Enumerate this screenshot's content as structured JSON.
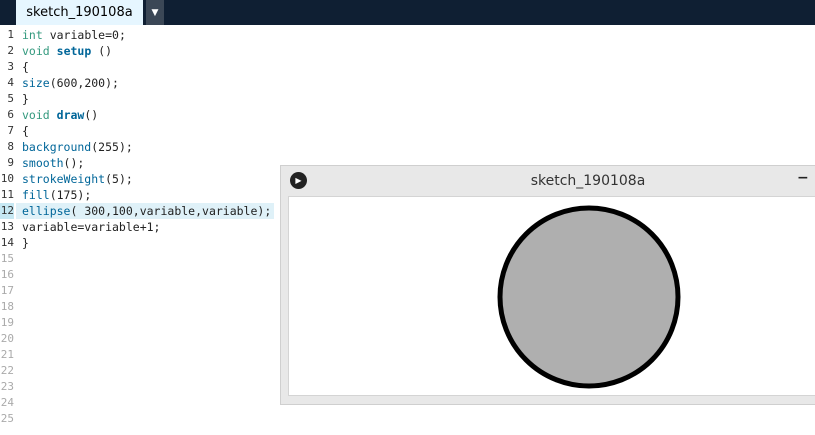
{
  "tab": {
    "label": "sketch_190108a",
    "menu_icon": "dropdown-triangle-icon"
  },
  "editor": {
    "current_line": 12,
    "line_numbers": [
      "1",
      "2",
      "3",
      "4",
      "5",
      "6",
      "7",
      "8",
      "9",
      "10",
      "11",
      "12",
      "13",
      "14",
      "15",
      "16",
      "17",
      "18",
      "19",
      "20",
      "21",
      "22",
      "23",
      "24",
      "25"
    ],
    "lines": [
      [
        {
          "t": "int",
          "c": "type"
        },
        {
          "t": " variable=0;",
          "c": ""
        }
      ],
      [
        {
          "t": "void",
          "c": "type"
        },
        {
          "t": " ",
          "c": ""
        },
        {
          "t": "setup",
          "c": "kw-bold"
        },
        {
          "t": " ()",
          "c": ""
        }
      ],
      [
        {
          "t": "{",
          "c": ""
        }
      ],
      [
        {
          "t": "size",
          "c": "fn"
        },
        {
          "t": "(600,200);",
          "c": ""
        }
      ],
      [
        {
          "t": "}",
          "c": ""
        }
      ],
      [
        {
          "t": "void",
          "c": "type"
        },
        {
          "t": " ",
          "c": ""
        },
        {
          "t": "draw",
          "c": "kw-bold"
        },
        {
          "t": "()",
          "c": ""
        }
      ],
      [
        {
          "t": "{",
          "c": ""
        }
      ],
      [
        {
          "t": "background",
          "c": "fn"
        },
        {
          "t": "(255);",
          "c": ""
        }
      ],
      [
        {
          "t": "smooth",
          "c": "fn"
        },
        {
          "t": "();",
          "c": ""
        }
      ],
      [
        {
          "t": "strokeWeight",
          "c": "fn"
        },
        {
          "t": "(5);",
          "c": ""
        }
      ],
      [
        {
          "t": "fill",
          "c": "fn"
        },
        {
          "t": "(175);",
          "c": ""
        }
      ],
      [
        {
          "t": "ellipse",
          "c": "fn"
        },
        {
          "t": "( 300,100,variable,variable);",
          "c": ""
        }
      ],
      [
        {
          "t": "variable=variable+1;",
          "c": ""
        }
      ],
      [
        {
          "t": "}",
          "c": ""
        }
      ]
    ]
  },
  "sketch_window": {
    "title": "sketch_190108a",
    "play_icon": "play-icon",
    "minimize_label": "−",
    "canvas": {
      "background": "#ffffff",
      "ellipse": {
        "fill": "#afafaf",
        "stroke": "#000000"
      }
    }
  }
}
